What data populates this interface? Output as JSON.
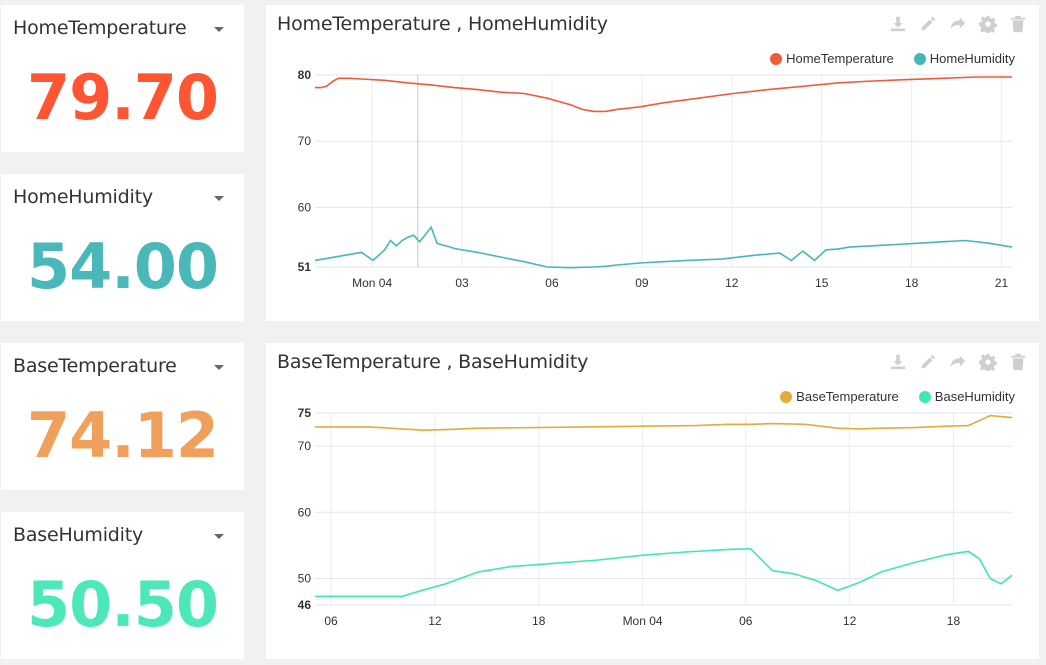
{
  "widgets": [
    {
      "title": "HomeTemperature",
      "value": "79.70",
      "color": "#ff5533"
    },
    {
      "title": "HomeHumidity",
      "value": "54.00",
      "color": "#4ab8b8"
    },
    {
      "title": "BaseTemperature",
      "value": "74.12",
      "color": "#f0a05a"
    },
    {
      "title": "BaseHumidity",
      "value": "50.50",
      "color": "#4de8b9"
    }
  ],
  "toolbar_icons": [
    "download-icon",
    "pencil-icon",
    "share-icon",
    "gear-icon",
    "trash-icon"
  ],
  "charts": [
    {
      "title": "HomeTemperature , HomeHumidity",
      "legend": [
        {
          "name": "HomeTemperature",
          "color": "#f05a3c"
        },
        {
          "name": "HomeHumidity",
          "color": "#44b8b8"
        }
      ]
    },
    {
      "title": "BaseTemperature , BaseHumidity",
      "legend": [
        {
          "name": "BaseTemperature",
          "color": "#e6aa3a"
        },
        {
          "name": "BaseHumidity",
          "color": "#3fe8b0"
        }
      ]
    }
  ],
  "chart_data": [
    {
      "type": "line",
      "title": "HomeTemperature , HomeHumidity",
      "xlabel": "",
      "ylabel": "",
      "x_ticks": [
        "Mon 04",
        "03",
        "06",
        "09",
        "12",
        "15",
        "18",
        "21"
      ],
      "y_ticks": [
        "80",
        "70",
        "60",
        "51"
      ],
      "ylim": [
        51,
        80
      ],
      "grid": true,
      "legend_position": "top-right",
      "series": [
        {
          "name": "HomeTemperature",
          "color": "#f05a3c",
          "x": [
            0,
            0.5,
            1,
            1.5,
            2,
            3,
            4,
            6,
            8,
            10,
            12,
            14,
            16,
            18,
            20,
            21,
            22,
            23,
            24,
            25,
            26,
            28,
            30,
            33,
            36,
            39,
            42,
            45,
            48,
            51,
            54,
            57,
            60
          ],
          "values": [
            78.1,
            78.1,
            78.3,
            79.0,
            79.5,
            79.5,
            79.4,
            79.2,
            78.8,
            78.5,
            78.1,
            77.8,
            77.4,
            77.2,
            76.5,
            76.0,
            75.5,
            74.8,
            74.5,
            74.5,
            74.8,
            75.2,
            75.8,
            76.5,
            77.2,
            77.8,
            78.3,
            78.8,
            79.1,
            79.3,
            79.5,
            79.7,
            79.7
          ]
        },
        {
          "name": "HomeHumidity",
          "color": "#44b8b8",
          "x": [
            0,
            2,
            4,
            5,
            6,
            6.5,
            7,
            7.5,
            8,
            8.5,
            9,
            10,
            10.5,
            11,
            11.5,
            12,
            14,
            16,
            18,
            20,
            22,
            24,
            25,
            26,
            28,
            30,
            32,
            35,
            38,
            40,
            41,
            42,
            43,
            44,
            45,
            46,
            48,
            50,
            52,
            54,
            56,
            58,
            60
          ],
          "values": [
            52.0,
            52.6,
            53.2,
            52.0,
            53.6,
            55.0,
            54.2,
            55.0,
            55.5,
            55.8,
            54.8,
            57.0,
            54.6,
            54.3,
            54.1,
            53.8,
            53.2,
            52.5,
            51.8,
            51.0,
            50.9,
            51.0,
            51.1,
            51.3,
            51.6,
            51.8,
            52.0,
            52.2,
            52.8,
            53.1,
            52.0,
            53.4,
            52.0,
            53.6,
            53.7,
            54.0,
            54.2,
            54.4,
            54.6,
            54.8,
            55.0,
            54.6,
            54.0
          ]
        }
      ]
    },
    {
      "type": "line",
      "title": "BaseTemperature , BaseHumidity",
      "xlabel": "",
      "ylabel": "",
      "x_ticks": [
        "06",
        "12",
        "18",
        "Mon 04",
        "06",
        "12",
        "18"
      ],
      "y_ticks": [
        "75",
        "70",
        "60",
        "50",
        "46"
      ],
      "ylim": [
        46,
        75
      ],
      "grid": true,
      "legend_position": "top-right",
      "series": [
        {
          "name": "BaseTemperature",
          "color": "#e6aa3a",
          "x": [
            0,
            5,
            8,
            10,
            12,
            15,
            20,
            25,
            30,
            35,
            38,
            40,
            42,
            45,
            48,
            50,
            52,
            55,
            58,
            60,
            62,
            64
          ],
          "values": [
            72.9,
            72.9,
            72.6,
            72.4,
            72.5,
            72.7,
            72.8,
            72.9,
            73.0,
            73.1,
            73.3,
            73.3,
            73.4,
            73.3,
            72.7,
            72.6,
            72.7,
            72.8,
            73.0,
            73.1,
            74.6,
            74.3
          ]
        },
        {
          "name": "BaseHumidity",
          "color": "#3fe8b0",
          "x": [
            0,
            8,
            10,
            12,
            15,
            18,
            22,
            26,
            30,
            34,
            38,
            40,
            42,
            44,
            46,
            48,
            50,
            52,
            55,
            58,
            60,
            61,
            62,
            63,
            64
          ],
          "values": [
            47.3,
            47.3,
            48.3,
            49.2,
            51.0,
            51.8,
            52.3,
            52.8,
            53.5,
            54.0,
            54.4,
            54.5,
            51.2,
            50.7,
            49.7,
            48.2,
            49.4,
            51.0,
            52.4,
            53.6,
            54.1,
            53.0,
            50.0,
            49.2,
            50.5
          ]
        }
      ]
    }
  ]
}
